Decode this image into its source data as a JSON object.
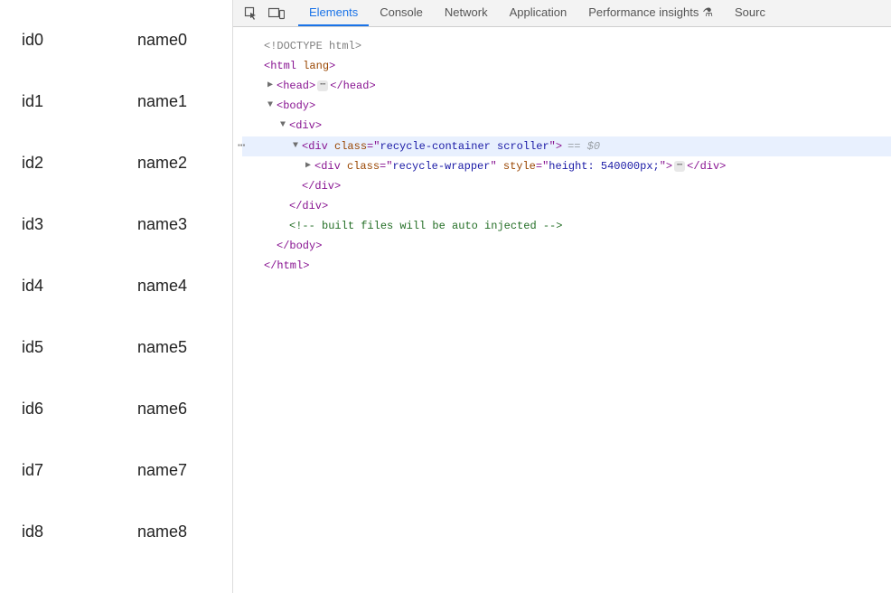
{
  "page": {
    "rows": [
      {
        "id": "id0",
        "name": "name0"
      },
      {
        "id": "id1",
        "name": "name1"
      },
      {
        "id": "id2",
        "name": "name2"
      },
      {
        "id": "id3",
        "name": "name3"
      },
      {
        "id": "id4",
        "name": "name4"
      },
      {
        "id": "id5",
        "name": "name5"
      },
      {
        "id": "id6",
        "name": "name6"
      },
      {
        "id": "id7",
        "name": "name7"
      },
      {
        "id": "id8",
        "name": "name8"
      }
    ]
  },
  "devtools": {
    "tabs": [
      {
        "label": "Elements",
        "active": true
      },
      {
        "label": "Console",
        "active": false
      },
      {
        "label": "Network",
        "active": false
      },
      {
        "label": "Application",
        "active": false
      },
      {
        "label": "Performance insights",
        "active": false,
        "badge": "⚗"
      },
      {
        "label": "Sourc",
        "active": false
      }
    ],
    "dom": {
      "line0": "<!DOCTYPE html>",
      "html_open": {
        "tag": "html",
        "attr": "lang"
      },
      "head": {
        "tag": "head"
      },
      "body": {
        "tag": "body"
      },
      "div1": {
        "tag": "div"
      },
      "div2": {
        "tag": "div",
        "class_attr": "class",
        "class_val": "recycle-container scroller",
        "suffix": "== $0"
      },
      "div3": {
        "tag": "div",
        "class_attr": "class",
        "class_val": "recycle-wrapper",
        "style_attr": "style",
        "style_val": "height: 540000px;"
      },
      "div2_close": "</div>",
      "div1_close": "</div>",
      "comment": " built files will be auto injected ",
      "body_close": "</body>",
      "html_close": "</html>"
    }
  }
}
